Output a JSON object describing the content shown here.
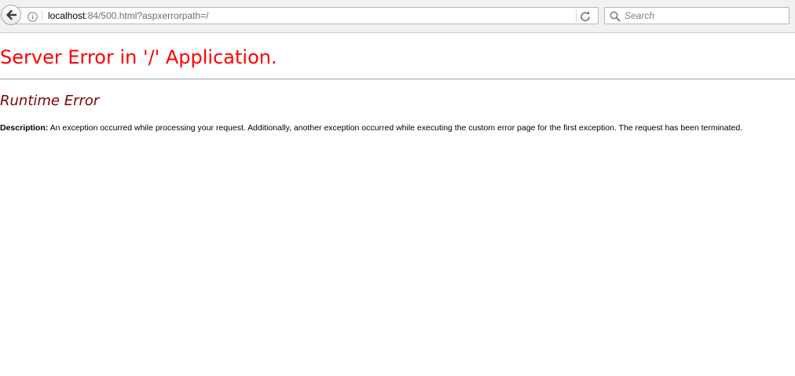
{
  "browser": {
    "url_host": "localhost",
    "url_rest": ":84/500.html?aspxerrorpath=/",
    "search_placeholder": "Search",
    "icons": {
      "back": "back-arrow-icon",
      "info": "info-icon",
      "reload": "reload-icon",
      "search": "search-icon"
    }
  },
  "page": {
    "heading": "Server Error in '/' Application.",
    "subheading": "Runtime Error",
    "description_label": "Description:",
    "description_text": " An exception occurred while processing your request. Additionally, another exception occurred while executing the custom error page for the first exception. The request has been terminated.",
    "colors": {
      "heading": "#ff0000",
      "subheading": "#800000"
    }
  }
}
